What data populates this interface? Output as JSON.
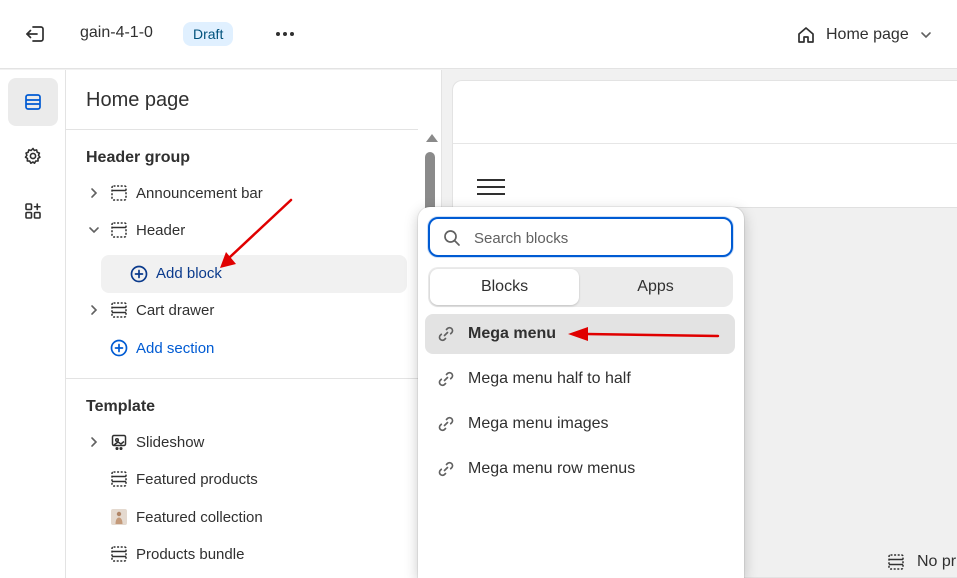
{
  "topbar": {
    "theme_name": "gain-4-1-0",
    "status_badge": "Draft",
    "page_selector": "Home page"
  },
  "rail": {
    "items": [
      {
        "icon": "sections-icon",
        "active": true
      },
      {
        "icon": "gear-icon",
        "active": false
      },
      {
        "icon": "apps-icon",
        "active": false
      }
    ]
  },
  "panel": {
    "title": "Home page",
    "header_group": {
      "title": "Header group",
      "items": [
        {
          "label": "Announcement bar",
          "expanded": false
        },
        {
          "label": "Header",
          "expanded": true
        },
        {
          "label": "Cart drawer",
          "expanded": false
        }
      ],
      "add_block_label": "Add block",
      "add_section_label": "Add section"
    },
    "template": {
      "title": "Template",
      "items": [
        {
          "label": "Slideshow"
        },
        {
          "label": "Featured products"
        },
        {
          "label": "Featured collection"
        },
        {
          "label": "Products bundle"
        }
      ]
    }
  },
  "popover": {
    "search_placeholder": "Search blocks",
    "tabs": [
      {
        "label": "Blocks",
        "active": true
      },
      {
        "label": "Apps",
        "active": false
      }
    ],
    "blocks": [
      {
        "label": "Mega menu",
        "highlighted": true
      },
      {
        "label": "Mega menu half to half",
        "highlighted": false
      },
      {
        "label": "Mega menu images",
        "highlighted": false
      },
      {
        "label": "Mega menu row menus",
        "highlighted": false
      }
    ]
  },
  "preview": {
    "footer_text": "No pr"
  },
  "colors": {
    "accent": "#005bd3",
    "annotation_arrow": "#e00000",
    "badge_bg": "#e0f0ff",
    "badge_text": "#00527c"
  }
}
